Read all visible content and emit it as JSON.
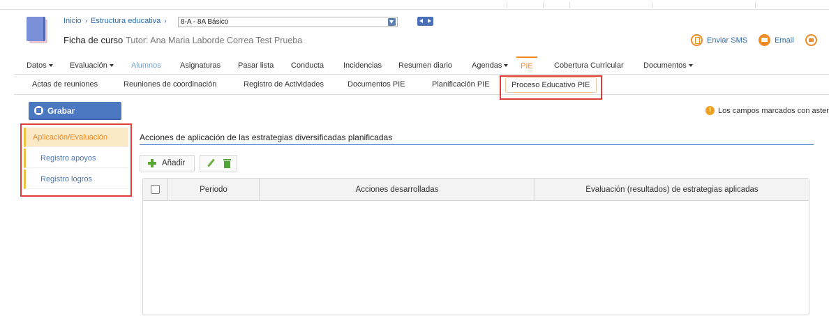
{
  "breadcrumb": {
    "home": "Inicio",
    "section": "Estructura educativa",
    "course_value": "8-A - 8A Básico"
  },
  "header": {
    "title": "Ficha de curso",
    "tutor": "Tutor: Ana Maria Laborde Correa Test Prueba",
    "sms_label": "Enviar SMS",
    "email_label": "Email"
  },
  "main_nav": [
    {
      "label": "Datos",
      "dropdown": true
    },
    {
      "label": "Evaluación",
      "dropdown": true
    },
    {
      "label": "Alumnos",
      "dropdown": false
    },
    {
      "label": "Asignaturas",
      "dropdown": false
    },
    {
      "label": "Pasar lista",
      "dropdown": false
    },
    {
      "label": "Conducta",
      "dropdown": false
    },
    {
      "label": "Incidencias",
      "dropdown": false
    },
    {
      "label": "Resumen diario",
      "dropdown": false
    },
    {
      "label": "Agendas",
      "dropdown": true
    },
    {
      "label": "PIE",
      "dropdown": false,
      "active": true
    },
    {
      "label": "Cobertura Curricular",
      "dropdown": false
    },
    {
      "label": "Documentos",
      "dropdown": true
    }
  ],
  "sub_nav": [
    {
      "label": "Actas de reuniones"
    },
    {
      "label": "Reuniones de coordinación"
    },
    {
      "label": "Registro de Actividades"
    },
    {
      "label": "Documentos PIE"
    },
    {
      "label": "Planificación PIE"
    },
    {
      "label": "Proceso Educativo PIE",
      "active": true
    }
  ],
  "toolbar": {
    "save_label": "Grabar",
    "notice": "Los campos marcados con asteris"
  },
  "sidebar": {
    "items": [
      {
        "label": "Aplicación/Evaluación",
        "active": true
      },
      {
        "label": "Registro apoyos"
      },
      {
        "label": "Registro logros"
      }
    ]
  },
  "content": {
    "section_title": "Acciones de aplicación de las estrategias diversificadas planificadas",
    "add_label": "Añadir",
    "table": {
      "columns": [
        "Periodo",
        "Acciones desarrolladas",
        "Evaluación (resultados) de estrategias aplicadas"
      ],
      "rows": []
    }
  },
  "colors": {
    "accent": "#f08a24",
    "primary": "#4c78c2",
    "link": "#2b6cb0",
    "highlight": "#e23b3b"
  }
}
